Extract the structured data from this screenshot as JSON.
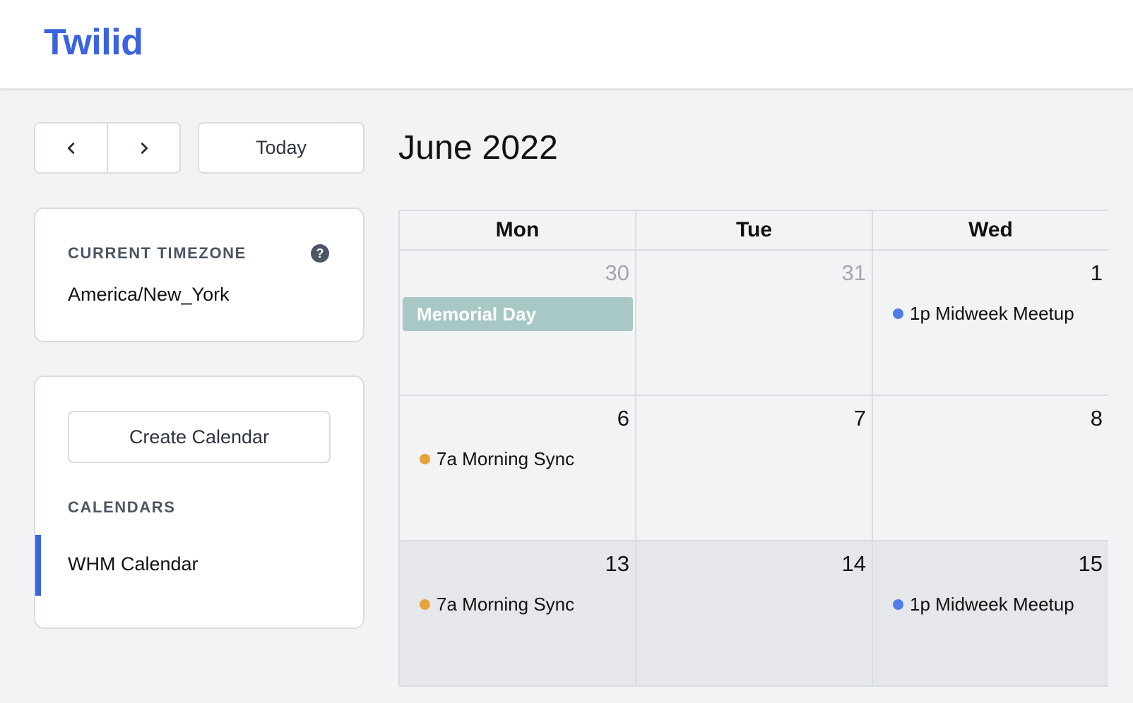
{
  "app": {
    "brand": "Twilid"
  },
  "toolbar": {
    "today_label": "Today",
    "month_title": "June 2022"
  },
  "timezone": {
    "label": "CURRENT TIMEZONE",
    "help_glyph": "?",
    "value": "America/New_York"
  },
  "calendars": {
    "create_label": "Create Calendar",
    "section_label": "CALENDARS",
    "items": [
      {
        "name": "WHM Calendar",
        "color": "#3a63df"
      }
    ]
  },
  "grid": {
    "headers": [
      "Mon",
      "Tue",
      "Wed"
    ],
    "weeks": [
      {
        "days": [
          {
            "num": "30",
            "muted": true,
            "allday": "Memorial Day"
          },
          {
            "num": "31",
            "muted": true
          },
          {
            "num": "1",
            "event": {
              "time": "1p",
              "title": "Midweek Meetup",
              "color": "#4f7de8"
            }
          }
        ]
      },
      {
        "days": [
          {
            "num": "6",
            "event": {
              "time": "7a",
              "title": "Morning Sync",
              "color": "#e8a23a"
            }
          },
          {
            "num": "7"
          },
          {
            "num": "8"
          }
        ]
      },
      {
        "shaded": true,
        "days": [
          {
            "num": "13",
            "event": {
              "time": "7a",
              "title": "Morning Sync",
              "color": "#e8a23a"
            }
          },
          {
            "num": "14"
          },
          {
            "num": "15",
            "event": {
              "time": "1p",
              "title": "Midweek Meetup",
              "color": "#4f7de8"
            }
          }
        ]
      }
    ]
  },
  "colors": {
    "accent": "#3a63df",
    "holiday": "#a8c8c6"
  }
}
